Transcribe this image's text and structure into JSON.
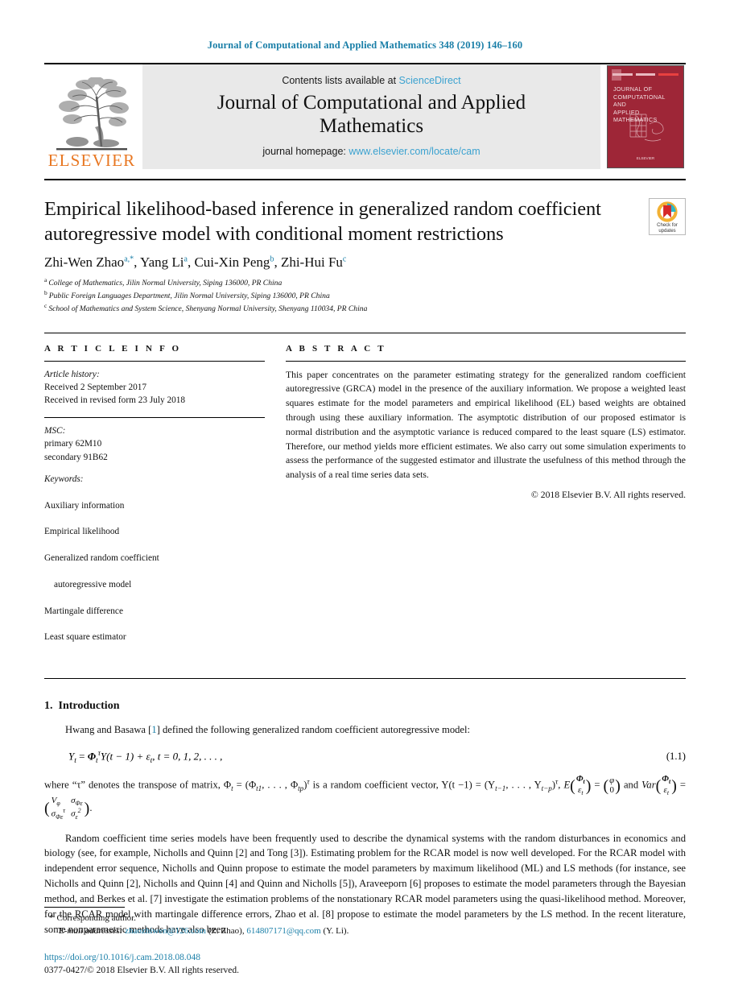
{
  "running_head": "Journal of Computational and Applied Mathematics 348 (2019) 146–160",
  "masthead": {
    "publisher_logo_name": "elsevier-tree-logo",
    "publisher_wordmark": "ELSEVIER",
    "contents_prefix": "Contents lists available at",
    "contents_link": "ScienceDirect",
    "journal_title": "Journal of Computational and Applied Mathematics",
    "homepage_prefix": "journal homepage:",
    "homepage_link": "www.elsevier.com/locate/cam",
    "cover": {
      "title_lines": "JOURNAL OF\nCOMPUTATIONAL AND\nAPPLIED MATHEMATICS",
      "foot_line": "ELSEVIER"
    }
  },
  "article": {
    "title": "Empirical likelihood-based inference in generalized random coefficient autoregressive model with conditional moment restrictions",
    "authors": [
      {
        "name": "Zhi-Wen Zhao",
        "marks": "a,*"
      },
      {
        "name": "Yang Li",
        "marks": "a"
      },
      {
        "name": "Cui-Xin Peng",
        "marks": "b"
      },
      {
        "name": "Zhi-Hui Fu",
        "marks": "c"
      }
    ],
    "affiliations": [
      {
        "mark": "a",
        "text": "College of Mathematics, Jilin Normal University, Siping 136000, PR China"
      },
      {
        "mark": "b",
        "text": "Public Foreign Languages Department, Jilin Normal University, Siping 136000, PR China"
      },
      {
        "mark": "c",
        "text": "School of Mathematics and System Science, Shenyang Normal University, Shenyang 110034, PR China"
      }
    ],
    "crossmark": {
      "line1": "Check for",
      "line2": "updates"
    }
  },
  "article_info": {
    "heading": "A R T I C L E   I N F O",
    "history_label": "Article history:",
    "history": "Received 2 September 2017\nReceived in revised form 23 July 2018",
    "msc_label": "MSC:",
    "msc": "primary 62M10\nsecondary 91B62",
    "keywords_label": "Keywords:",
    "keywords": [
      {
        "text": "Auxiliary information",
        "indent": false
      },
      {
        "text": "Empirical likelihood",
        "indent": false
      },
      {
        "text": "Generalized random coefficient",
        "indent": false
      },
      {
        "text": "autoregressive model",
        "indent": true
      },
      {
        "text": "Martingale difference",
        "indent": false
      },
      {
        "text": "Least square estimator",
        "indent": false
      }
    ]
  },
  "abstract": {
    "heading": "A B S T R A C T",
    "text": "This paper concentrates on the parameter estimating strategy for the generalized random coefficient autoregressive (GRCA) model in the presence of the auxiliary information. We propose a weighted least squares estimate for the model parameters and empirical likelihood (EL) based weights are obtained through using these auxiliary information. The asymptotic distribution of our proposed estimator is normal distribution and the asymptotic variance is reduced compared to the least square (LS) estimator. Therefore, our method yields more efficient estimates. We also carry out some simulation experiments to assess the performance of the suggested estimator and illustrate the usefulness of this method through the analysis of a real time series data sets.",
    "copyright": "© 2018 Elsevier B.V. All rights reserved."
  },
  "body": {
    "section_number": "1.",
    "section_title": "Introduction",
    "para1_a": "Hwang and Basawa [",
    "para1_ref": "1",
    "para1_b": "] defined the following generalized random coefficient autoregressive model:",
    "equation": {
      "lhs": "Y",
      "lhs_sub": "t",
      "eq": "=",
      "phi": "Φ",
      "phi_sub": "t",
      "phi_sup": "τ",
      "mid": "Y(t − 1) + ε",
      "mid_sub": "t",
      "tail": ", t = 0, 1, 2, . . . ,",
      "number": "(1.1)"
    },
    "para2_line1": "where “τ” denotes the transpose of matrix, Φ",
    "para2_line1b": " = (Φ",
    "para2_line1c": ", . . . , Φ",
    "para2_line1d": ")",
    "para2_line1e": " is a random coefficient vector, Y(t −1) = (Y",
    "para2_line1f": ", . . . , Y",
    "para2_line1g": ")",
    "para2_line1h": ",",
    "para2_E": "E",
    "para2_and": "and",
    "para2_Var": "Var",
    "para3": "Random coefficient time series models have been frequently used to describe the dynamical systems with the random disturbances in economics and biology (see, for example, Nicholls and Quinn [2] and Tong [3]). Estimating problem for the RCAR model is now well developed. For the RCAR model with independent error sequence, Nicholls and Quinn propose to estimate the model parameters by maximum likelihood (ML) and LS methods (for instance, see Nicholls and Quinn [2], Nicholls and Quinn [4] and Quinn and Nicholls [5]), Araveeporn [6] proposes to estimate the model parameters through the Bayesian method, and Berkes et al. [7] investigate the estimation problems of the nonstationary RCAR model parameters using the quasi-likelihood method. Moreover, for the RCAR model with martingale difference errors, Zhao et al. [8] propose to estimate the model parameters by the LS method. In the recent literature, some nonparametric methods have also been"
  },
  "footnote": {
    "star": "*",
    "corresponding": "Corresponding author.",
    "email_label": "E-mail addresses:",
    "email1": "zhaozhiwen@126.com",
    "email1_who": "(Z. Zhao),",
    "email2": "614807171@qq.com",
    "email2_who": "(Y. Li).",
    "doi": "https://doi.org/10.1016/j.cam.2018.08.048",
    "issn_line": "0377-0427/© 2018 Elsevier B.V. All rights reserved."
  },
  "colors": {
    "link_blue": "#1a7fa8",
    "sd_blue": "#3BA2D0",
    "elsevier_orange": "#E87722",
    "cover_red": "#9e2637",
    "band_grey": "#e9e9e9"
  }
}
